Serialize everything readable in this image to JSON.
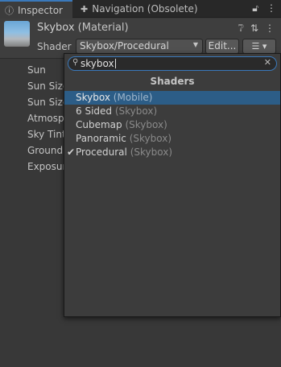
{
  "tabs": {
    "inspector": {
      "label": "Inspector",
      "icon": "info-icon"
    },
    "navigation": {
      "label": "Navigation (Obsolete)",
      "icon": "navigation-icon"
    }
  },
  "header": {
    "title": "Skybox",
    "subtitle": "(Material)",
    "shader_label": "Shader",
    "shader_value": "Skybox/Procedural",
    "edit_label": "Edit..."
  },
  "properties": [
    "Sun",
    "Sun Size",
    "Sun Size Convergence",
    "Atmosphere Thickness",
    "Sky Tint",
    "Ground",
    "Exposure"
  ],
  "popup": {
    "search_value": "skybox",
    "section_title": "Shaders",
    "items": [
      {
        "name": "Skybox",
        "category": "(Mobile)",
        "selected": true,
        "checked": false
      },
      {
        "name": "6 Sided",
        "category": "(Skybox)",
        "selected": false,
        "checked": false
      },
      {
        "name": "Cubemap",
        "category": "(Skybox)",
        "selected": false,
        "checked": false
      },
      {
        "name": "Panoramic",
        "category": "(Skybox)",
        "selected": false,
        "checked": false
      },
      {
        "name": "Procedural",
        "category": "(Skybox)",
        "selected": false,
        "checked": true
      }
    ]
  },
  "colors": {
    "panel_bg": "#383838",
    "accent": "#3a79bb",
    "selection": "#2c5d87"
  }
}
